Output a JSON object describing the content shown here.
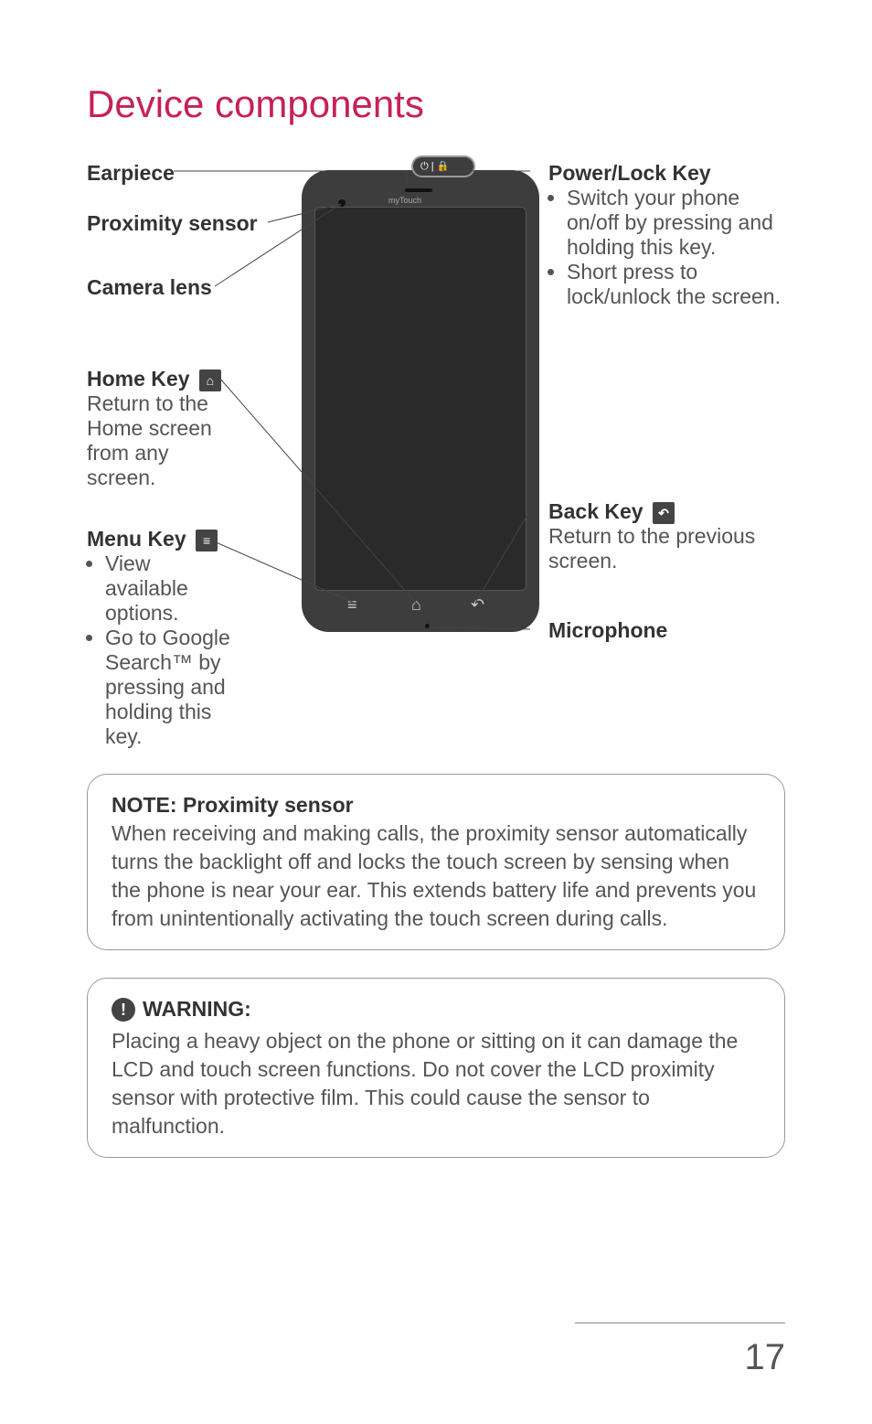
{
  "title": "Device components",
  "labels": {
    "earpiece": "Earpiece",
    "proximity": "Proximity sensor",
    "camera": "Camera lens",
    "home": "Home Key",
    "home_desc": "Return to the Home screen from any screen.",
    "menu": "Menu Key",
    "menu_b1": "View available options.",
    "menu_b2": "Go to Google Search™ by pressing and holding this key.",
    "power": "Power/Lock Key",
    "power_b1": "Switch your phone on/off by pressing and holding this key.",
    "power_b2": "Short press to lock/unlock the screen.",
    "back": "Back Key",
    "back_desc": "Return to the previous screen.",
    "mic": "Microphone"
  },
  "phone": {
    "brand": "myTouch",
    "power_glyph": "⏻ | 🔒"
  },
  "note": {
    "title": "NOTE: Proximity sensor",
    "body": "When receiving and making calls, the proximity sensor automatically turns the backlight off and locks the touch screen by sensing when the phone is near your ear. This extends battery life and prevents you from unintentionally activating the touch screen during calls."
  },
  "warning": {
    "title": "WARNING:",
    "body": "Placing a heavy object on the phone or sitting on it can damage the LCD and touch screen functions. Do not cover the LCD proximity sensor with protective film. This could cause the sensor to malfunction."
  },
  "page_number": "17"
}
